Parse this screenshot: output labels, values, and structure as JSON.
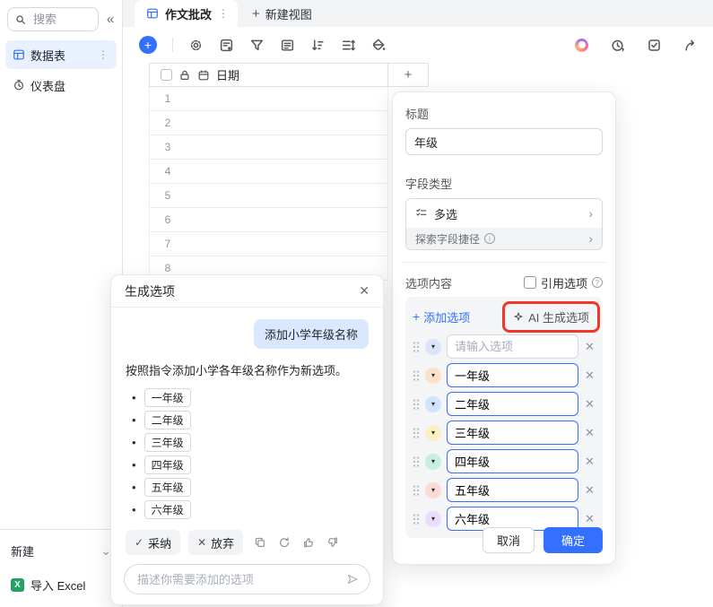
{
  "colors": {
    "accent": "#3370ff",
    "highlight_box": "#f0372c",
    "selected_item_bg": "#e9f1ff",
    "user_bubble_bg": "#d9e8ff"
  },
  "glyphs": {
    "collapse": "«",
    "more": "⋮",
    "plus": "+",
    "close": "✕",
    "chevron_right": "›",
    "chevron_down": "⌄",
    "triangle_down": "▾",
    "bullet": "•",
    "check": "✓",
    "cross": "✕",
    "question": "?",
    "info": "i",
    "excel_letter": "X"
  },
  "sidebar": {
    "search_placeholder": "搜索",
    "items": [
      {
        "label": "数据表"
      },
      {
        "label": "仪表盘"
      }
    ],
    "new_label": "新建",
    "import_label": "导入 Excel"
  },
  "tabs": {
    "active": "作文批改",
    "new_view": "新建视图"
  },
  "toolbar": {
    "icons": [
      "add-record",
      "settings-gear",
      "field-config",
      "filter",
      "card-view",
      "sort",
      "row-height",
      "paint-bucket"
    ],
    "right_icons": [
      "ai-assistant",
      "history-clock",
      "task-checkbox",
      "share-arrow"
    ]
  },
  "table": {
    "header": {
      "name": "日期"
    },
    "add_column": "+",
    "rows": [
      "1",
      "2",
      "3",
      "4",
      "5",
      "6",
      "7",
      "8"
    ]
  },
  "panel": {
    "title_label": "标题",
    "title_value": "年级",
    "field_type_label": "字段类型",
    "field_type_value": "多选",
    "shortcut_label": "探索字段捷径",
    "options_label": "选项内容",
    "reference_label": "引用选项",
    "add_option_label": "添加选项",
    "ai_generate_label": "AI 生成选项",
    "options": [
      {
        "value": "",
        "placeholder": "请输入选项",
        "color": "#dce3f9"
      },
      {
        "value": "一年级",
        "color": "#fde2c8"
      },
      {
        "value": "二年级",
        "color": "#cfe4fb"
      },
      {
        "value": "三年级",
        "color": "#faf0c3"
      },
      {
        "value": "四年级",
        "color": "#c7efe0"
      },
      {
        "value": "五年级",
        "color": "#fcd9d4"
      },
      {
        "value": "六年级",
        "color": "#e9ddfb"
      }
    ],
    "cancel_label": "取消",
    "confirm_label": "确定"
  },
  "dialog": {
    "title": "生成选项",
    "user_message": "添加小学年级名称",
    "response": "按照指令添加小学各年级名称作为新选项。",
    "items": [
      "一年级",
      "二年级",
      "三年级",
      "四年级",
      "五年级",
      "六年级"
    ],
    "accept_label": "采纳",
    "discard_label": "放弃",
    "action_icons": [
      "copy",
      "regenerate",
      "thumb-up",
      "thumb-down"
    ],
    "input_placeholder": "描述你需要添加的选项"
  }
}
